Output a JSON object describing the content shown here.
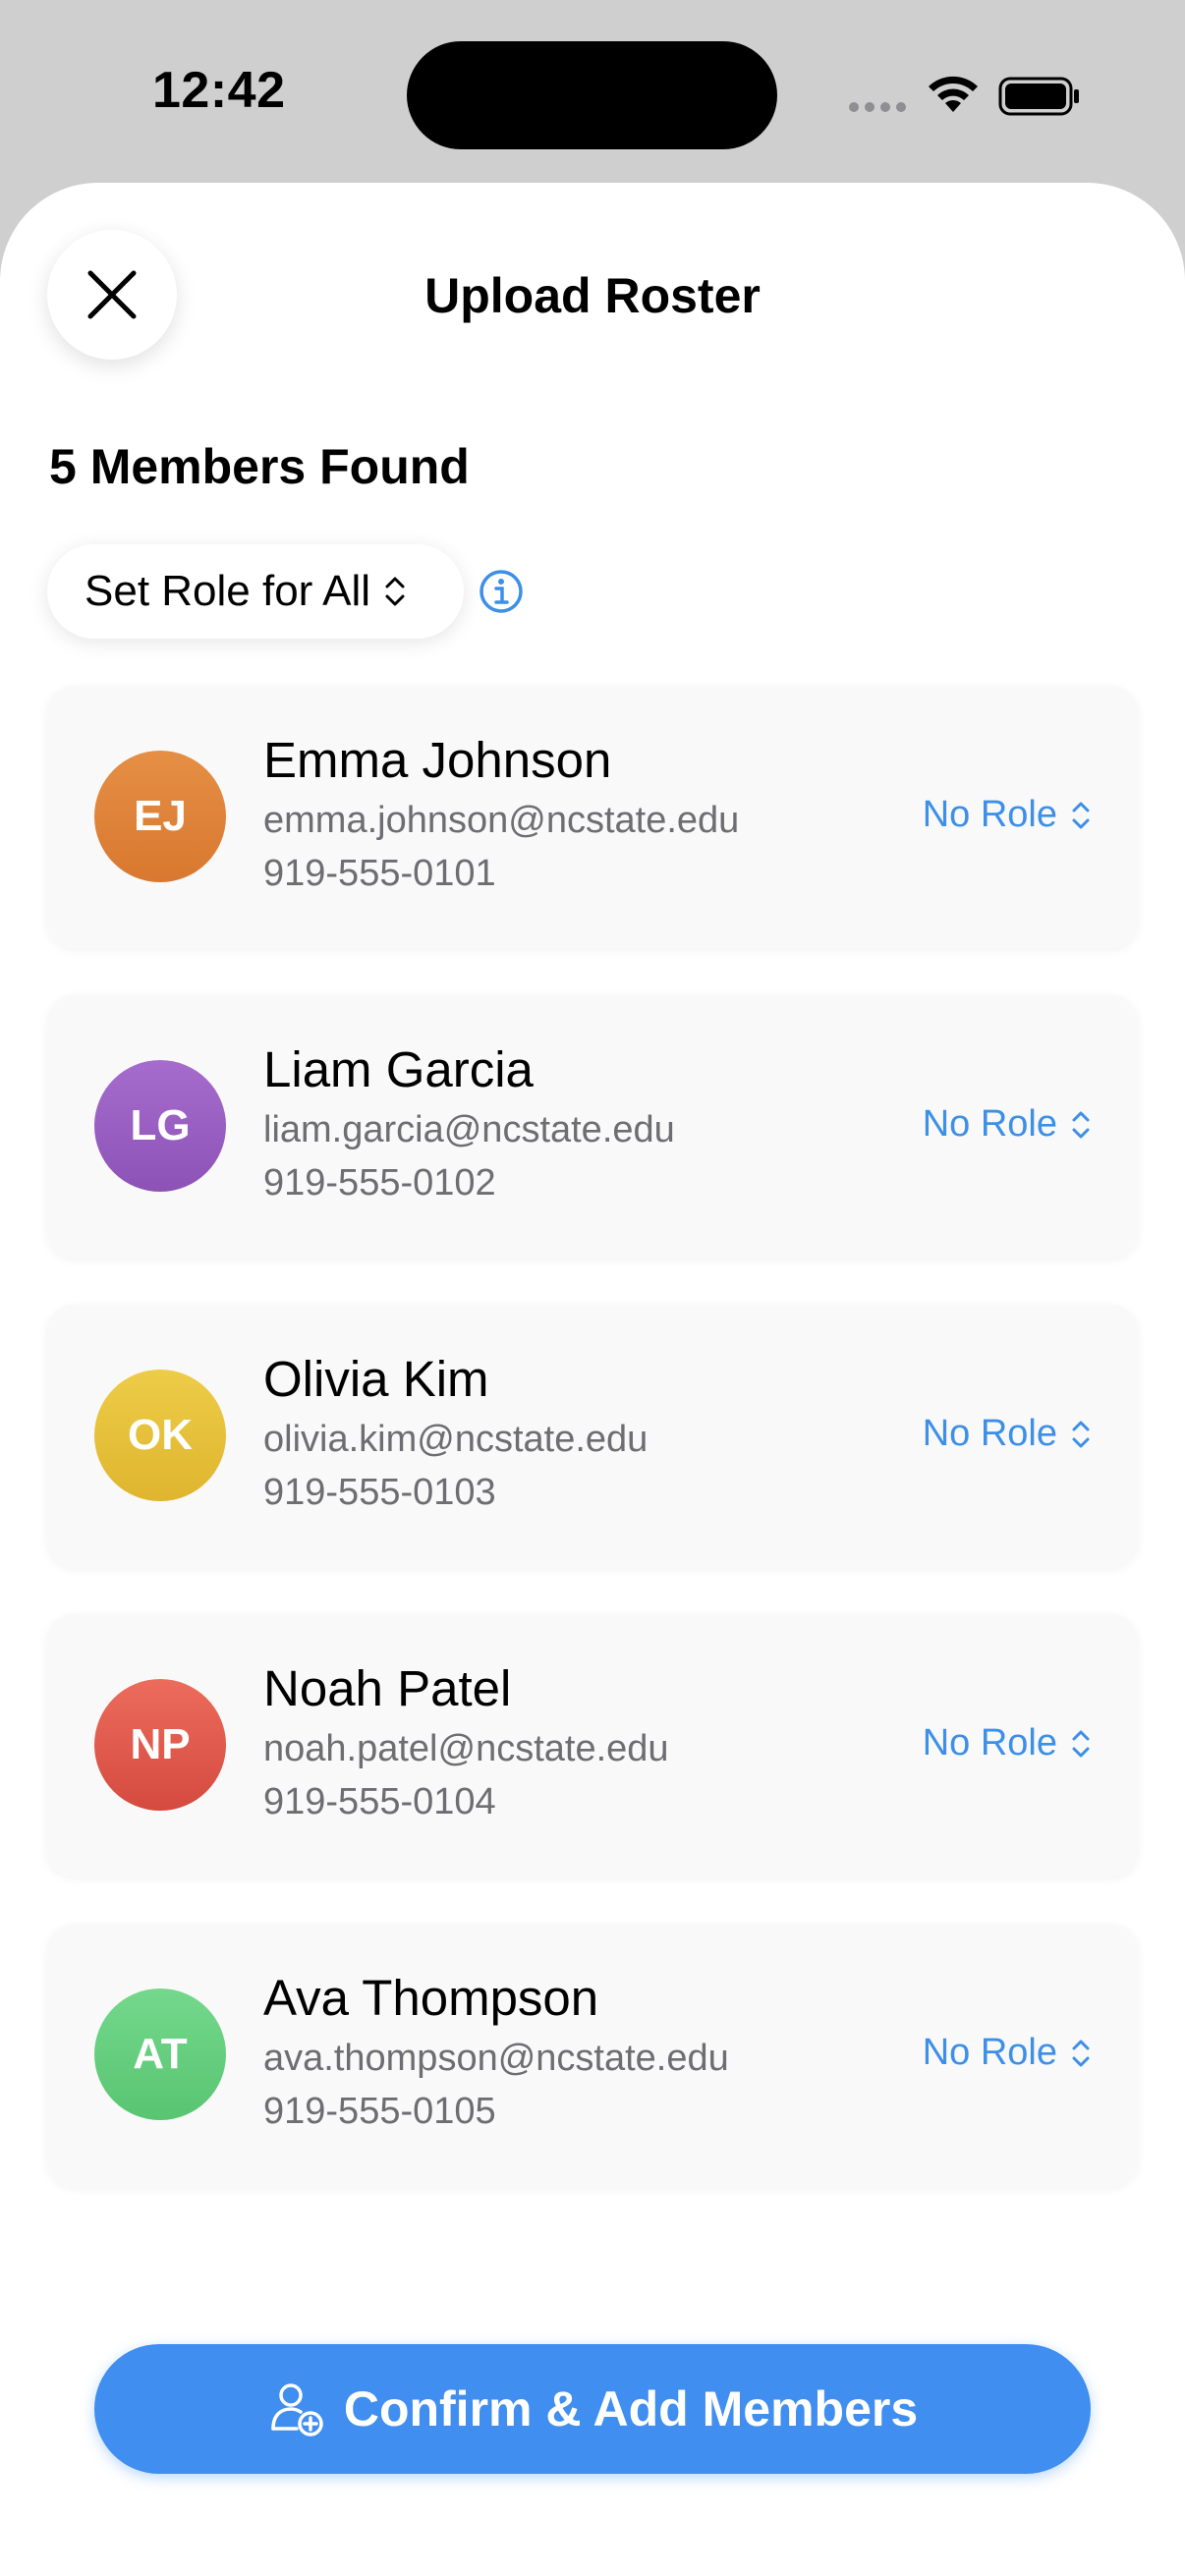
{
  "status_bar": {
    "time": "12:42"
  },
  "sheet": {
    "title": "Upload Roster",
    "members_found": "5 Members Found",
    "set_role_all_label": "Set Role for All"
  },
  "members": [
    {
      "initials": "EJ",
      "name": "Emma Johnson",
      "email": "emma.johnson@ncstate.edu",
      "phone": "919-555-0101",
      "role": "No Role",
      "color": "#e0883e"
    },
    {
      "initials": "LG",
      "name": "Liam Garcia",
      "email": "liam.garcia@ncstate.edu",
      "phone": "919-555-0102",
      "role": "No Role",
      "color": "#9d62c4"
    },
    {
      "initials": "OK",
      "name": "Olivia Kim",
      "email": "olivia.kim@ncstate.edu",
      "phone": "919-555-0103",
      "role": "No Role",
      "color": "#e8c43c"
    },
    {
      "initials": "NP",
      "name": "Noah Patel",
      "email": "noah.patel@ncstate.edu",
      "phone": "919-555-0104",
      "role": "No Role",
      "color": "#e2574c"
    },
    {
      "initials": "AT",
      "name": "Ava Thompson",
      "email": "ava.thompson@ncstate.edu",
      "phone": "919-555-0105",
      "role": "No Role",
      "color": "#62ce7c"
    }
  ],
  "confirm_button": {
    "label": "Confirm & Add Members"
  },
  "colors": {
    "accent": "#3f8ef0",
    "role_link": "#3d8fe8"
  },
  "icons": [
    "close-icon",
    "chevron-updown-icon",
    "info-icon",
    "add-user-icon",
    "wifi-icon",
    "battery-icon"
  ]
}
